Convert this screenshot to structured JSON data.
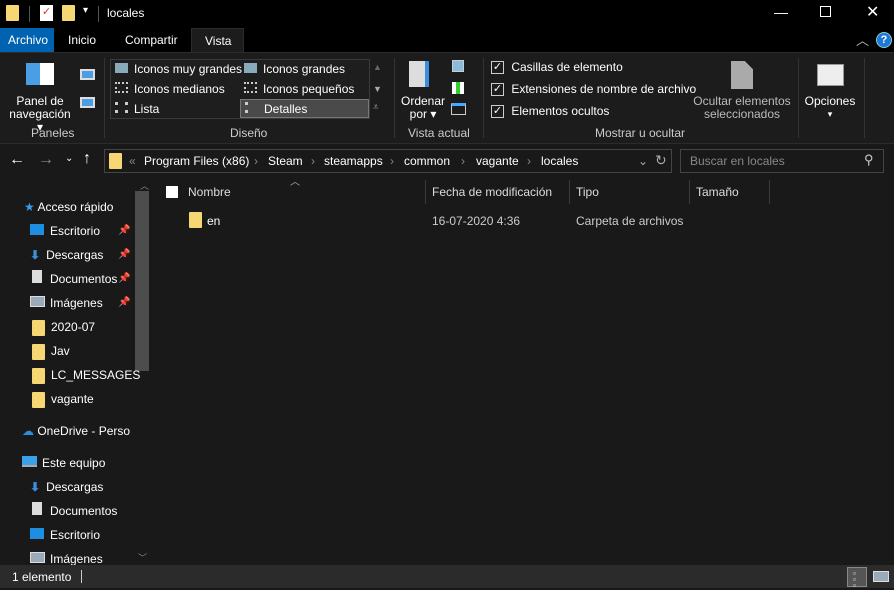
{
  "window": {
    "title": "locales"
  },
  "tabs": [
    {
      "label": "Archivo"
    },
    {
      "label": "Inicio"
    },
    {
      "label": "Compartir"
    },
    {
      "label": "Vista"
    }
  ],
  "ribbon": {
    "paneles": {
      "nav_pane": "Panel de",
      "nav_pane2": "navegación",
      "group": "Paneles"
    },
    "diseno": {
      "items": [
        "Iconos muy grandes",
        "Iconos grandes",
        "Iconos medianos",
        "Iconos pequeños",
        "Lista",
        "Detalles"
      ],
      "selected": "Detalles",
      "group": "Diseño"
    },
    "vista_actual": {
      "sort": "Ordenar",
      "sort2": "por",
      "group": "Vista actual"
    },
    "mostrar": {
      "checks": [
        {
          "label": "Casillas de elemento",
          "checked": true
        },
        {
          "label": "Extensiones de nombre de archivo",
          "checked": true
        },
        {
          "label": "Elementos ocultos",
          "checked": true
        }
      ],
      "hide1": "Ocultar elementos",
      "hide2": "seleccionados",
      "group": "Mostrar u ocultar"
    },
    "opciones": "Opciones"
  },
  "address": {
    "overflow": "«",
    "crumbs": [
      "Program Files (x86)",
      "Steam",
      "steamapps",
      "common",
      "vagante",
      "locales"
    ]
  },
  "search": {
    "placeholder": "Buscar en locales"
  },
  "sidebar": {
    "quick": "Acceso rápido",
    "quick_items": [
      {
        "label": "Escritorio",
        "icon": "desktop",
        "pinned": true
      },
      {
        "label": "Descargas",
        "icon": "download",
        "pinned": true
      },
      {
        "label": "Documentos",
        "icon": "document",
        "pinned": true
      },
      {
        "label": "Imágenes",
        "icon": "image",
        "pinned": true
      },
      {
        "label": "2020-07",
        "icon": "folder"
      },
      {
        "label": "Jav",
        "icon": "folder"
      },
      {
        "label": "LC_MESSAGES",
        "icon": "folder"
      },
      {
        "label": "vagante",
        "icon": "folder"
      }
    ],
    "onedrive": "OneDrive - Perso",
    "pc": "Este equipo",
    "pc_items": [
      {
        "label": "Descargas",
        "icon": "download"
      },
      {
        "label": "Documentos",
        "icon": "document"
      },
      {
        "label": "Escritorio",
        "icon": "desktop"
      },
      {
        "label": "Imágenes",
        "icon": "image"
      }
    ]
  },
  "columns": [
    "Nombre",
    "Fecha de modificación",
    "Tipo",
    "Tamaño"
  ],
  "files": [
    {
      "name": "en",
      "date": "16-07-2020 4:36",
      "type": "Carpeta de archivos",
      "size": ""
    }
  ],
  "status": {
    "count": "1 elemento"
  },
  "colors": {
    "accent": "#0063b1",
    "folder": "#f7d774"
  }
}
